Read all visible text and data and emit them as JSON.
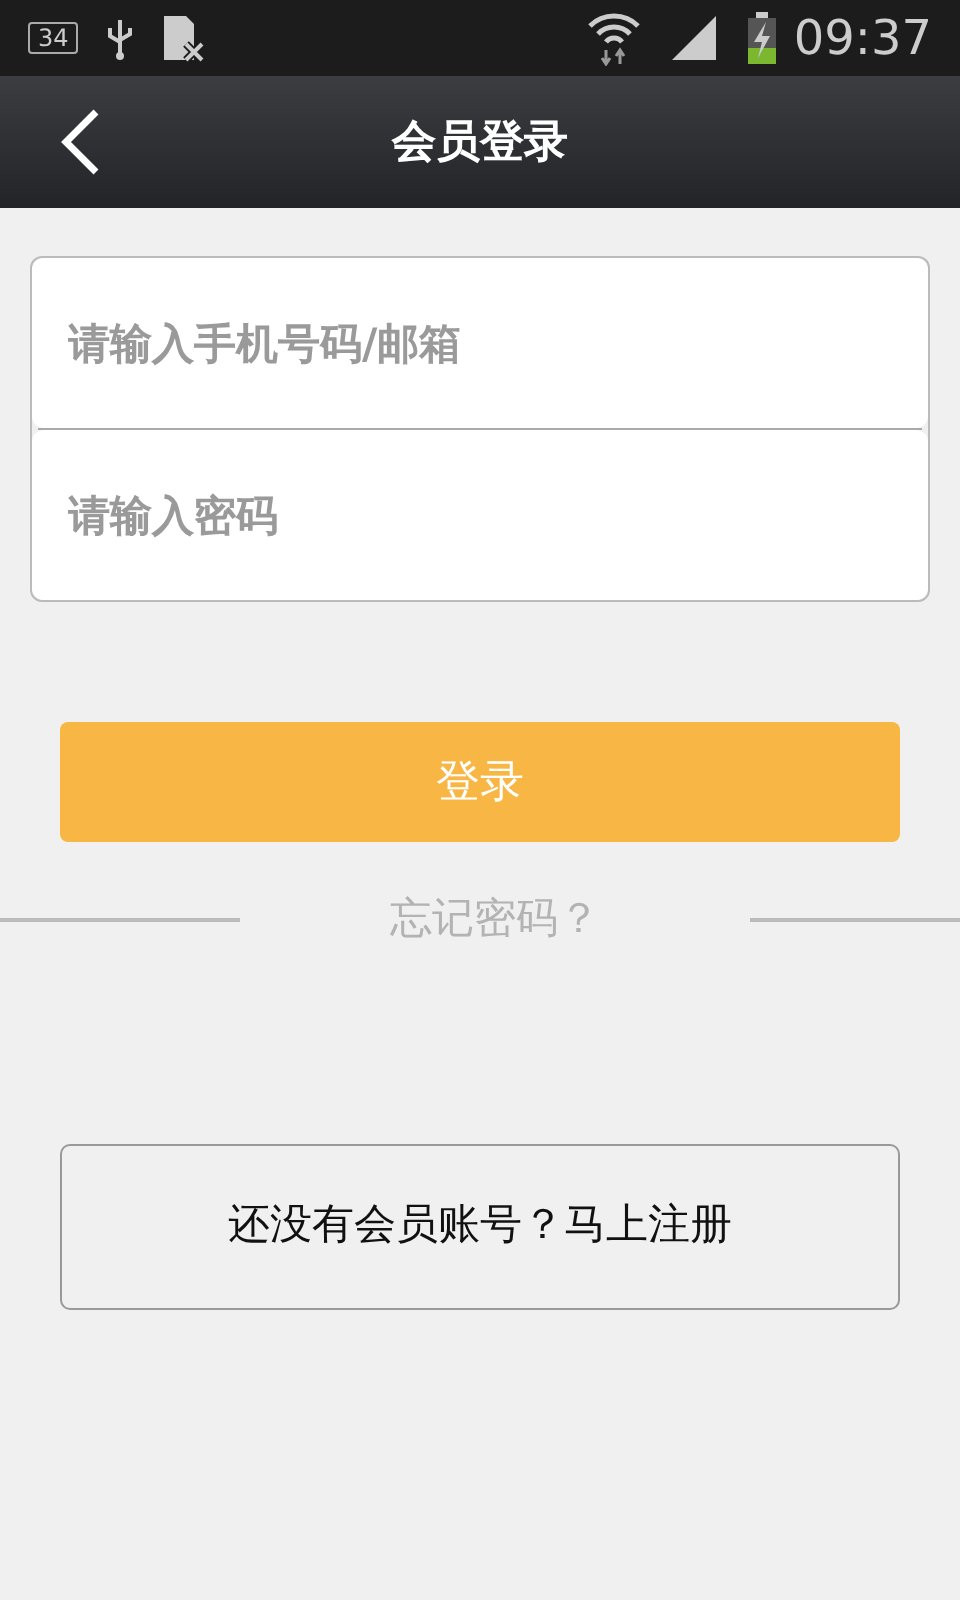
{
  "status_bar": {
    "notification_count": "34",
    "time": "09:37"
  },
  "header": {
    "title": "会员登录"
  },
  "form": {
    "fields": [
      {
        "placeholder": "请输入手机号码/邮箱"
      },
      {
        "placeholder": "请输入密码"
      }
    ]
  },
  "login_button": "登录",
  "forgot_password": "忘记密码？",
  "register_button": "还没有会员账号？马上注册"
}
